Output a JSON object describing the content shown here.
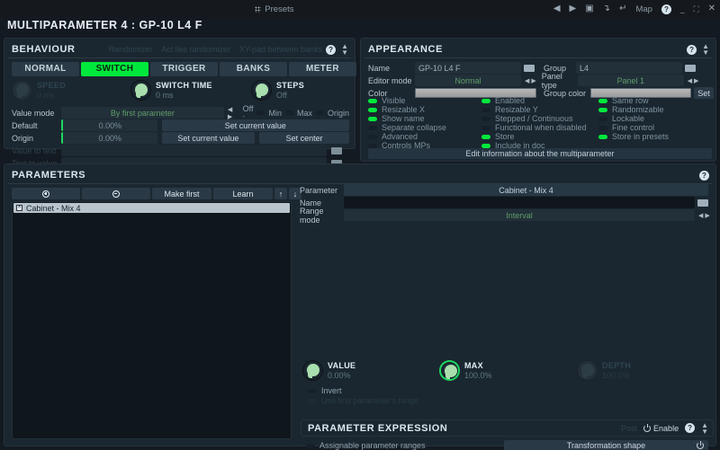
{
  "titlebar": {
    "presets_label": "Presets",
    "map_label": "Map",
    "icons": {
      "grid": "grid-icon",
      "prev": "◀",
      "next": "▶",
      "save": "▣",
      "undo": "↴",
      "redo": "↵",
      "help": "?",
      "minimize": "_",
      "maximize": "⛶",
      "close": "✕"
    }
  },
  "window": {
    "title": "MULTIPARAMETER 4 : GP-10 L4 F"
  },
  "behaviour": {
    "title": "BEHAVIOUR",
    "dim_options": [
      "Randomizer",
      "Act like randomizer",
      "XY-pad between banks"
    ],
    "tabs": [
      {
        "label": "NORMAL",
        "active": false
      },
      {
        "label": "SWITCH",
        "active": true
      },
      {
        "label": "TRIGGER",
        "active": false
      },
      {
        "label": "BANKS",
        "active": false
      },
      {
        "label": "METER",
        "active": false
      }
    ],
    "knobs": [
      {
        "name": "SPEED",
        "value": "0 ms",
        "disabled": true
      },
      {
        "name": "SWITCH TIME",
        "value": "0 ms",
        "disabled": false
      },
      {
        "name": "STEPS",
        "value": "Off",
        "disabled": false
      }
    ],
    "value_mode": {
      "label": "Value mode",
      "value": "By first parameter"
    },
    "off_label": "Off :",
    "off_toggles": [
      {
        "label": "Min",
        "on": false
      },
      {
        "label": "Max",
        "on": false
      },
      {
        "label": "Origin",
        "on": false
      }
    ],
    "default": {
      "label": "Default",
      "value": "0.00%",
      "button": "Set current value"
    },
    "origin": {
      "label": "Origin",
      "value": "0.00%",
      "button1": "Set current value",
      "button2": "Set center"
    },
    "value_to_text": {
      "label": "Value to text",
      "value": ""
    },
    "text_to_value": {
      "label": "Text to value",
      "value": ""
    }
  },
  "appearance": {
    "title": "APPEARANCE",
    "name": {
      "label": "Name",
      "value": "GP-10 L4 F"
    },
    "group": {
      "label": "Group",
      "value": "L4"
    },
    "editor_mode": {
      "label": "Editor mode",
      "value": "Normal"
    },
    "panel_type": {
      "label": "Panel type",
      "value": "Panel 1"
    },
    "color": {
      "label": "Color"
    },
    "group_color": {
      "label": "Group color",
      "set_label": "Set"
    },
    "checkboxes_col1": [
      {
        "label": "Visible",
        "on": true
      },
      {
        "label": "Resizable X",
        "on": true
      },
      {
        "label": "Show name",
        "on": true
      },
      {
        "label": "Separate collapse",
        "on": false
      },
      {
        "label": "Advanced",
        "on": false
      },
      {
        "label": "Controls MPs",
        "on": false
      }
    ],
    "checkboxes_col2": [
      {
        "label": "Enabled",
        "on": true
      },
      {
        "label": "Resizable Y",
        "on": false
      },
      {
        "label": "Stepped / Continuous",
        "on": false
      },
      {
        "label": "Functional when disabled",
        "on": false
      },
      {
        "label": "Store",
        "on": true
      },
      {
        "label": "Include in doc",
        "on": true
      }
    ],
    "checkboxes_col3": [
      {
        "label": "Same row",
        "on": true
      },
      {
        "label": "Randomizable",
        "on": true
      },
      {
        "label": "Lockable",
        "on": false
      },
      {
        "label": "Fine control",
        "on": false
      },
      {
        "label": "Store in presets",
        "on": true
      }
    ],
    "edit_info_button": "Edit information about the multiparameter"
  },
  "parameters": {
    "title": "PARAMETERS",
    "toolbar": {
      "add": "add-button",
      "remove": "remove-button",
      "make_first": "Make first",
      "learn": "Learn",
      "up": "↑",
      "down": "↓"
    },
    "list": [
      {
        "label": "Cabinet - Mix 4",
        "selected": true
      }
    ],
    "detail": {
      "parameter": {
        "label": "Parameter",
        "value": "Cabinet - Mix 4"
      },
      "name": {
        "label": "Name",
        "value": ""
      },
      "range_mode": {
        "label": "Range mode",
        "value": "Interval"
      },
      "knobs": [
        {
          "name": "VALUE",
          "value": "0.00%",
          "disabled": false,
          "ring": false
        },
        {
          "name": "MAX",
          "value": "100.0%",
          "disabled": false,
          "ring": true
        },
        {
          "name": "DEPTH",
          "value": "100.0%",
          "disabled": true,
          "ring": false
        }
      ],
      "invert": {
        "label": "Invert",
        "on": false
      },
      "use_first_range": {
        "label": "Use first parameter's range",
        "on": false
      }
    }
  },
  "parameter_expression": {
    "title": "PARAMETER EXPRESSION",
    "post_label": "Post",
    "enable_label": "Enable",
    "assignable_ranges": {
      "label": "Assignable parameter ranges",
      "on": false
    },
    "transformation_shape": "Transformation shape"
  },
  "colors": {
    "accent_green": "#00e83c",
    "panel_bg": "#1b2730",
    "window_bg": "#141a21",
    "titlebar_bg": "#15191e"
  }
}
